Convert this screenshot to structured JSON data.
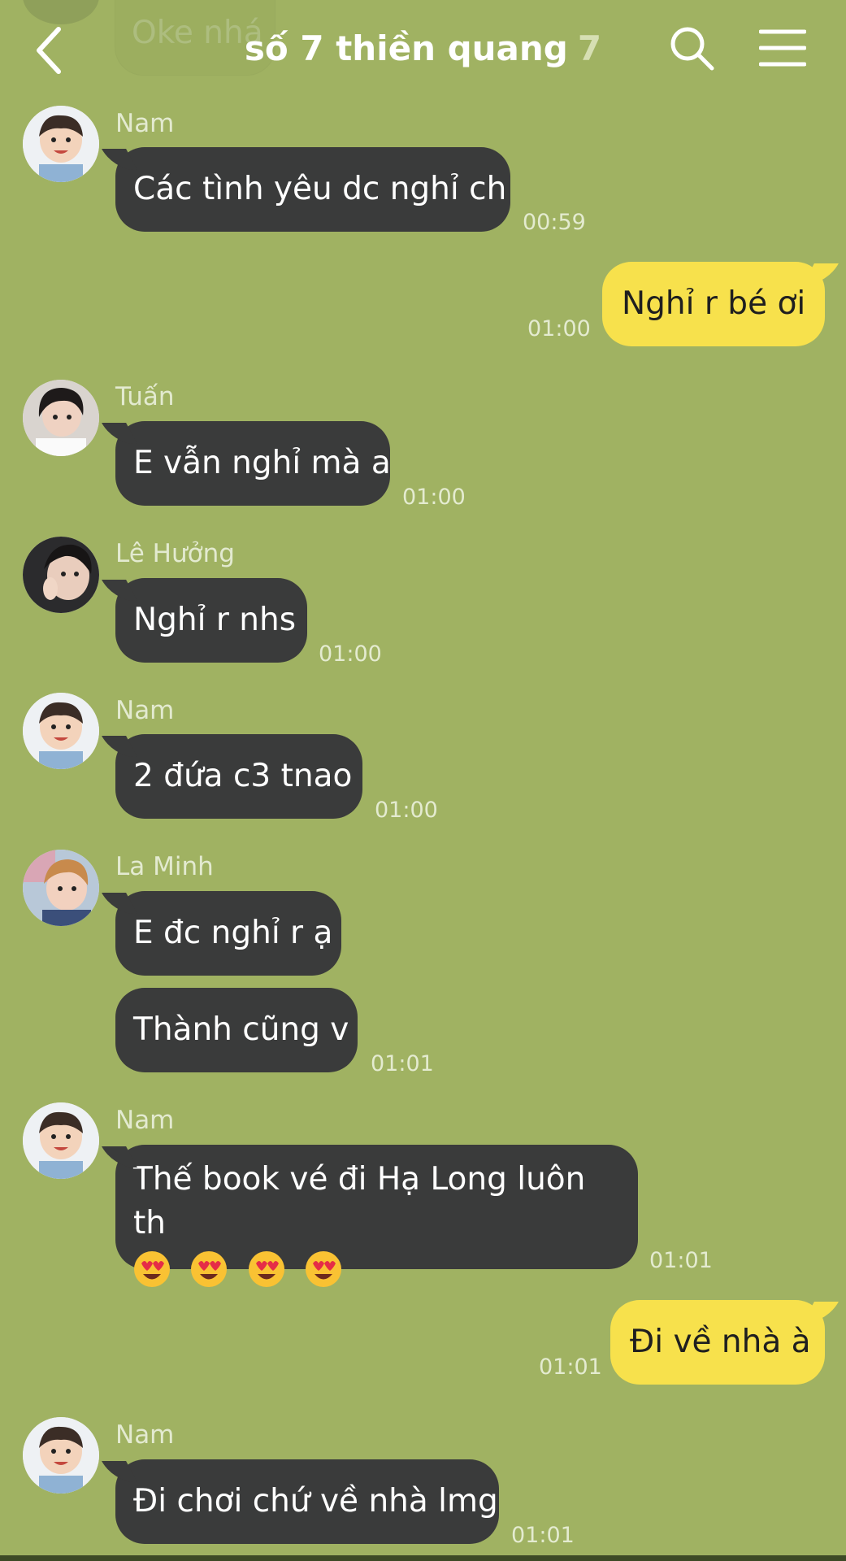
{
  "header": {
    "prev_message_text": "Oke nhá",
    "title": "số 7 thiền quang",
    "member_count": "7"
  },
  "messages": [
    {
      "sender": "Nam",
      "text": "Các tình yêu dc nghỉ ch",
      "time": "00:59"
    },
    {
      "sender": "me",
      "text": "Nghỉ r bé ơi",
      "time": "01:00"
    },
    {
      "sender": "Tuấn",
      "text": "E vẫn nghỉ mà a",
      "time": "01:00"
    },
    {
      "sender": "Lê Hưởng",
      "text": "Nghỉ r nhs",
      "time": "01:00"
    },
    {
      "sender": "Nam",
      "text": "2 đứa c3 tnao",
      "time": "01:00"
    },
    {
      "sender": "La Minh",
      "text": "E đc nghỉ r ạ",
      "time": ""
    },
    {
      "sender": "La Minh",
      "text": "Thành cũng v",
      "time": "01:01"
    },
    {
      "sender": "Nam",
      "text": "Thế book vé đi Hạ Long luôn th",
      "emoji_count": 4,
      "emoji": "heart-eyes-emoji",
      "time": "01:01"
    },
    {
      "sender": "me",
      "text": "Đi về nhà à",
      "time": "01:01"
    },
    {
      "sender": "Nam",
      "text": "Đi chơi chứ về nhà lmg",
      "time": "01:01"
    }
  ],
  "colors": {
    "background": "#a0b262",
    "incoming_bubble": "#3a3b3b",
    "outgoing_bubble": "#f7e14c"
  },
  "icons": [
    "back-arrow-icon",
    "search-icon",
    "menu-icon"
  ]
}
